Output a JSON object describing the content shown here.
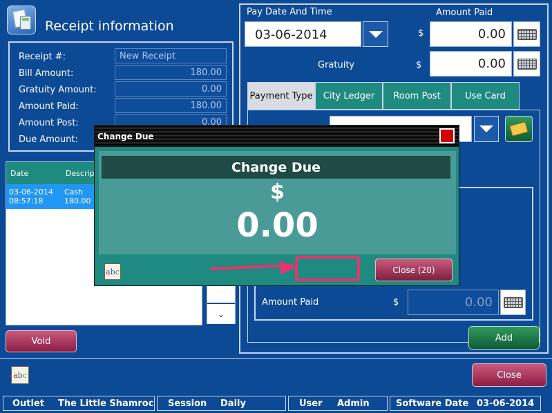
{
  "header": {
    "title": "Receipt information",
    "app_icon": "receipt-calculator-icon"
  },
  "receipt": {
    "receipt_no_label": "Receipt #:",
    "receipt_no_value": "New Receipt",
    "bill_amount_label": "Bill Amount:",
    "bill_amount_value": "180.00",
    "gratuity_amount_label": "Gratuity Amount:",
    "gratuity_amount_value": "0.00",
    "amount_paid_label": "Amount Paid:",
    "amount_paid_value": "180.00",
    "amount_post_label": "Amount Post:",
    "amount_post_value": "0.00",
    "due_amount_label": "Due Amount:"
  },
  "list": {
    "col_date": "Date",
    "col_desc": "Descrip",
    "rows": [
      {
        "date": "03-06-2014",
        "time": "08:57:18",
        "type": "Cash",
        "amount": "180.00"
      }
    ]
  },
  "side_scroll": {
    "down_glyph": "⌄"
  },
  "buttons": {
    "void": "Void",
    "close": "Close",
    "add": "Add"
  },
  "payment": {
    "pay_date_label": "Pay Date And Time",
    "pay_date_value": "03-06-2014",
    "amount_paid_label": "Amount Paid",
    "currency": "$",
    "amount_paid_value": "0.00",
    "gratuity_label": "Gratuity",
    "gratuity_value": "0.00",
    "tabs": [
      "Payment Type",
      "City Ledger",
      "Room Post",
      "Use Card"
    ],
    "inner_amount_paid_label": "Amount Paid",
    "inner_amount_paid_value": "0.00"
  },
  "modal": {
    "window_title": "Change Due",
    "heading": "Change Due",
    "currency": "$",
    "amount": "0.00",
    "close_label": "Close (20)"
  },
  "status_bar": {
    "outlet_label": "Outlet",
    "outlet_value": "The Little Shamrock",
    "session_label": "Session",
    "session_value": "Daily",
    "user_label": "User",
    "user_value": "Admin",
    "software_date_label": "Software Date",
    "software_date_value": "03-06-2014"
  },
  "colors": {
    "background": "#0d4a96",
    "teal": "#1f8a80",
    "selected_row": "#2196f3",
    "annotation": "#e8336f",
    "close_red": "#d00000"
  }
}
